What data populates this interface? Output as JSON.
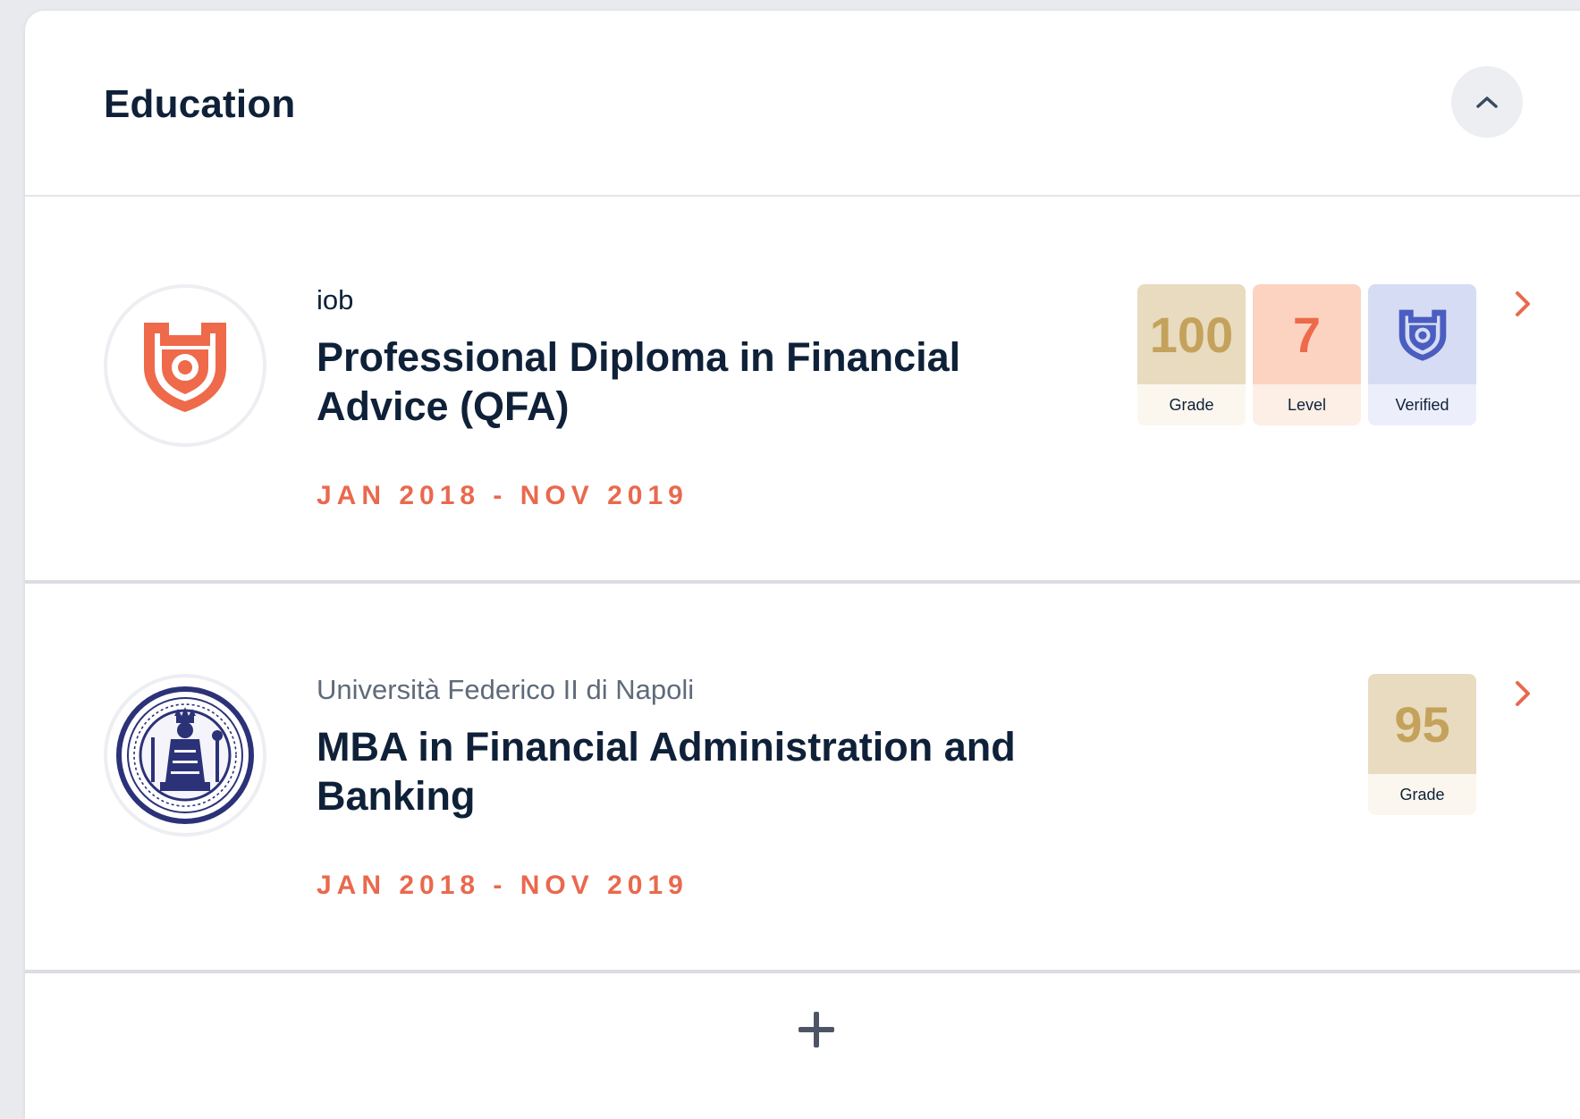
{
  "section": {
    "title": "Education"
  },
  "education": [
    {
      "institution": "iob",
      "degree": "Professional Diploma in Financial Advice (QFA)",
      "dates": "JAN 2018 - NOV 2019",
      "badges": {
        "grade": {
          "value": "100",
          "label": "Grade"
        },
        "level": {
          "value": "7",
          "label": "Level"
        },
        "verified": {
          "label": "Verified",
          "icon": "shield-icon"
        }
      },
      "logo_icon": "iob-shield-icon"
    },
    {
      "institution": "Università Federico II di Napoli",
      "degree": "MBA in Financial Administration and Banking",
      "dates": "JAN 2018 - NOV 2019",
      "badges": {
        "grade": {
          "value": "95",
          "label": "Grade"
        }
      },
      "logo_icon": "university-seal-icon"
    }
  ],
  "colors": {
    "accent": "#e9694e",
    "text": "#0f2138",
    "grade_bg": "#e8dbbf",
    "grade_text": "#c4a25b",
    "level_bg": "#fcd3c1",
    "verified_bg": "#d6dcf4",
    "verified_icon": "#4a5dc0"
  }
}
